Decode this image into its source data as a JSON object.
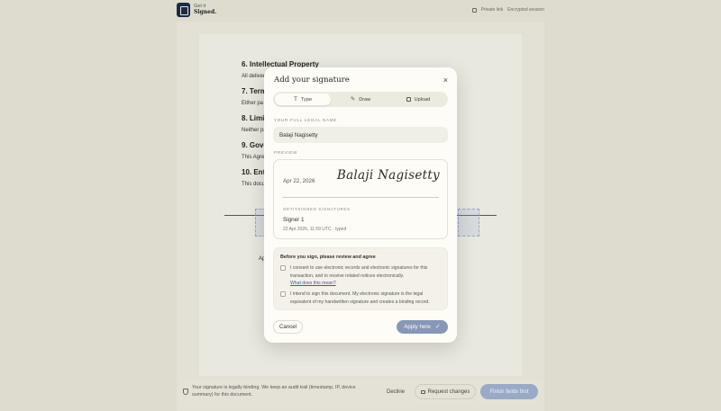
{
  "app": {
    "brand_line1": "Get it",
    "brand_line2": "Signed.",
    "private_link": "Private link",
    "encrypted": "Encrypted session"
  },
  "document": {
    "sections": [
      {
        "heading": "6. Intellectual Property",
        "text": "All deliver"
      },
      {
        "heading": "7. Term",
        "text": "Either pa"
      },
      {
        "heading": "8. Limi",
        "text": "Neither pa"
      },
      {
        "heading": "9. Gove",
        "text": "This Agre"
      },
      {
        "heading": "10. Ent",
        "text": "This docu"
      }
    ],
    "sig_label_fragment": "Ap"
  },
  "modal": {
    "title": "Add your signature",
    "close": "×",
    "tabs": [
      {
        "label": "Type",
        "icon": "text-icon",
        "active": true
      },
      {
        "label": "Draw",
        "icon": "pen-icon",
        "active": false
      },
      {
        "label": "Upload",
        "icon": "image-icon",
        "active": false
      }
    ],
    "name_label": "YOUR FULL LEGAL NAME",
    "name_value": "Balaji Nagisetty",
    "preview_label": "PREVIEW",
    "preview": {
      "date": "Apr 22, 2026",
      "signature": "Balaji Nagisetty",
      "caption": "GETITSIGNED SIGNATURES",
      "signer": "Signer 1",
      "meta": "22 Apr 2026, 11:59 UTC · typed"
    },
    "agree": {
      "title": "Before you sign, please review and agree",
      "items": [
        {
          "text": "I consent to use electronic records and electronic signatures for this transaction, and to receive related notices electronically.",
          "link": "What does this mean?"
        },
        {
          "text": "I intend to sign this document. My electronic signature is the legal equivalent of my handwritten signature and creates a binding record.",
          "link": ""
        }
      ]
    },
    "cancel": "Cancel",
    "apply": "Apply here",
    "apply_icon": "check-icon"
  },
  "bottom_bar": {
    "notice": "Your signature is legally binding. We keep an audit trail (timestamp, IP, device summary) for this document.",
    "decline": "Decline",
    "request_changes": "Request changes",
    "finish": "Finish fields first"
  },
  "colors": {
    "backdrop": "#dddccf",
    "modal_bg": "#fdfcf6",
    "accent_button": "#8797b5",
    "link": "#3e5e9b"
  }
}
